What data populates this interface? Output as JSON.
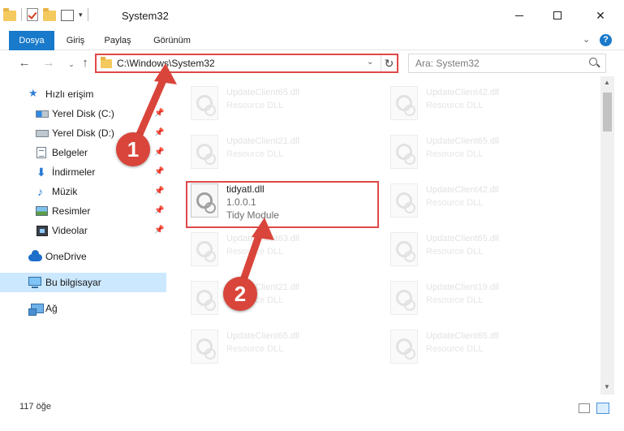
{
  "window": {
    "title": "System32"
  },
  "quick_access_toolbar": {
    "icons": [
      "folder-icon",
      "properties-check-icon",
      "folder-icon",
      "properties-icon",
      "customize-arrow-icon"
    ]
  },
  "ribbon": {
    "tabs": [
      "Dosya",
      "Giriş",
      "Paylaş",
      "Görünüm"
    ],
    "active_tab_color": "#1979ca"
  },
  "navigation": {
    "address": "C:\\Windows\\System32",
    "search_placeholder": "Ara: System32"
  },
  "sidebar": {
    "items": [
      {
        "label": "Hızlı erişim",
        "icon": "star-icon"
      },
      {
        "label": "Yerel Disk (C:)",
        "icon": "windows-drive-icon",
        "pinned": true
      },
      {
        "label": "Yerel Disk (D:)",
        "icon": "drive-icon",
        "pinned": true
      },
      {
        "label": "Belgeler",
        "icon": "document-icon",
        "pinned": true
      },
      {
        "label": "İndirmeler",
        "icon": "download-icon",
        "pinned": true
      },
      {
        "label": "Müzik",
        "icon": "music-icon",
        "pinned": true
      },
      {
        "label": "Resimler",
        "icon": "pictures-icon",
        "pinned": true
      },
      {
        "label": "Videolar",
        "icon": "video-icon",
        "pinned": true
      },
      {
        "label": "OneDrive",
        "icon": "cloud-icon"
      },
      {
        "label": "Bu bilgisayar",
        "icon": "computer-icon",
        "selected": true
      },
      {
        "label": "Ağ",
        "icon": "network-icon"
      }
    ]
  },
  "files": [
    {
      "name": "UpdateClient65.dll",
      "type": "Resource DLL",
      "faded": true
    },
    {
      "name": "UpdateClient42.dll",
      "type": "Resource DLL",
      "faded": true
    },
    {
      "name": "UpdateClient21.dll",
      "type": "Resource DLL",
      "faded": true
    },
    {
      "name": "UpdateClient65.dll",
      "type": "Resource DLL",
      "faded": true
    },
    {
      "name": "tidyatl.dll",
      "version": "1.0.0.1",
      "type": "Tidy Module",
      "faded": false
    },
    {
      "name": "UpdateClient42.dll",
      "type": "Resource DLL",
      "faded": true
    },
    {
      "name": "UpdateClient63.dll",
      "type": "Resource DLL",
      "faded": true
    },
    {
      "name": "UpdateClient65.dll",
      "type": "Resource DLL",
      "faded": true
    },
    {
      "name": "UpdateClient21.dll",
      "type": "Resource DLL",
      "faded": true
    },
    {
      "name": "UpdateClient19.dll",
      "type": "Resource DLL",
      "faded": true
    },
    {
      "name": "UpdateClient65.dll",
      "type": "Resource DLL",
      "faded": true
    },
    {
      "name": "UpdateClient65.dll",
      "type": "Resource DLL",
      "faded": true
    }
  ],
  "annotations": {
    "step1": "1",
    "step2": "2",
    "color": "#d9453a"
  },
  "status": {
    "item_count": "117 öğe"
  }
}
